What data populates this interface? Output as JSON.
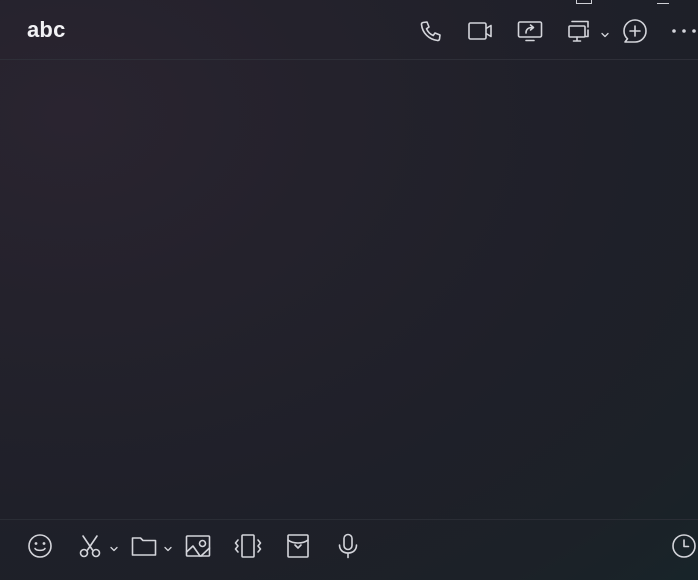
{
  "header": {
    "title": "abc",
    "actions": [
      {
        "name": "voice-call",
        "icon": "phone-icon"
      },
      {
        "name": "video-call",
        "icon": "video-camera-icon"
      },
      {
        "name": "screen-share",
        "icon": "screen-share-icon"
      },
      {
        "name": "remote-assist",
        "icon": "remote-screen-icon"
      },
      {
        "name": "add-member",
        "icon": "plus-bubble-icon"
      },
      {
        "name": "more",
        "icon": "more-icon"
      }
    ]
  },
  "toolbar": {
    "tools": [
      {
        "name": "emoji",
        "icon": "smiley-icon"
      },
      {
        "name": "screenshot",
        "icon": "scissors-icon"
      },
      {
        "name": "file",
        "icon": "folder-icon"
      },
      {
        "name": "image",
        "icon": "image-icon"
      },
      {
        "name": "shake",
        "icon": "vibrate-icon"
      },
      {
        "name": "red-packet",
        "icon": "envelope-icon"
      },
      {
        "name": "voice-message",
        "icon": "microphone-icon"
      },
      {
        "name": "history",
        "icon": "clock-icon"
      }
    ]
  },
  "colors": {
    "icon": "#d4d5db",
    "title": "#f2f2f5",
    "divider": "#2e2f38"
  }
}
